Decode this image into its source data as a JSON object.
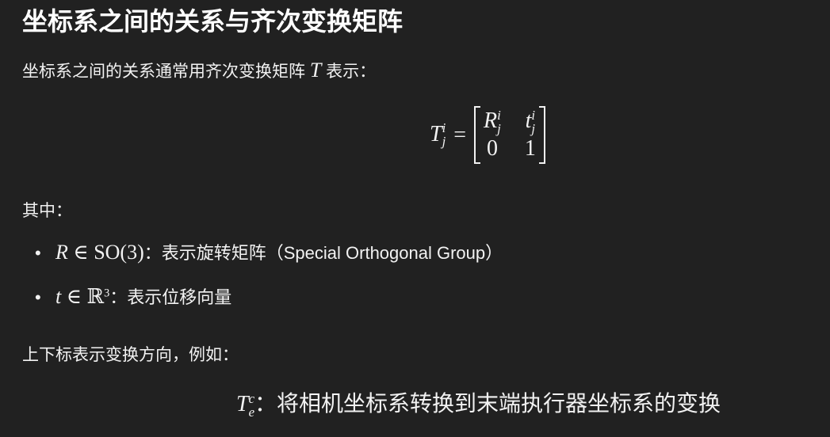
{
  "title": "坐标系之间的关系与齐次变换矩阵",
  "intro": {
    "text": "坐标系之间的关系通常用齐次变换矩阵",
    "symbol": "T",
    "suffix": "表示："
  },
  "matrix": {
    "lhs": "T",
    "lhs_sup": "i",
    "lhs_sub": "j",
    "eq": "=",
    "r": "R",
    "t": "t",
    "sup": "i",
    "sub": "j",
    "zero": "0",
    "one": "1"
  },
  "where": "其中：",
  "bullets": [
    {
      "math": "R ∈ ",
      "math_rm": "SO(3)",
      "text": "：表示旋转矩阵（Special Orthogonal Group）"
    },
    {
      "math": "t ∈ ",
      "math_rm": "ℝ",
      "sup": "3",
      "text": "：表示位移向量"
    }
  ],
  "example_intro": "上下标表示变换方向，例如：",
  "example": {
    "sym": "T",
    "sup": "c",
    "sub": "e",
    "text": "：将相机坐标系转换到末端执行器坐标系的变换"
  }
}
